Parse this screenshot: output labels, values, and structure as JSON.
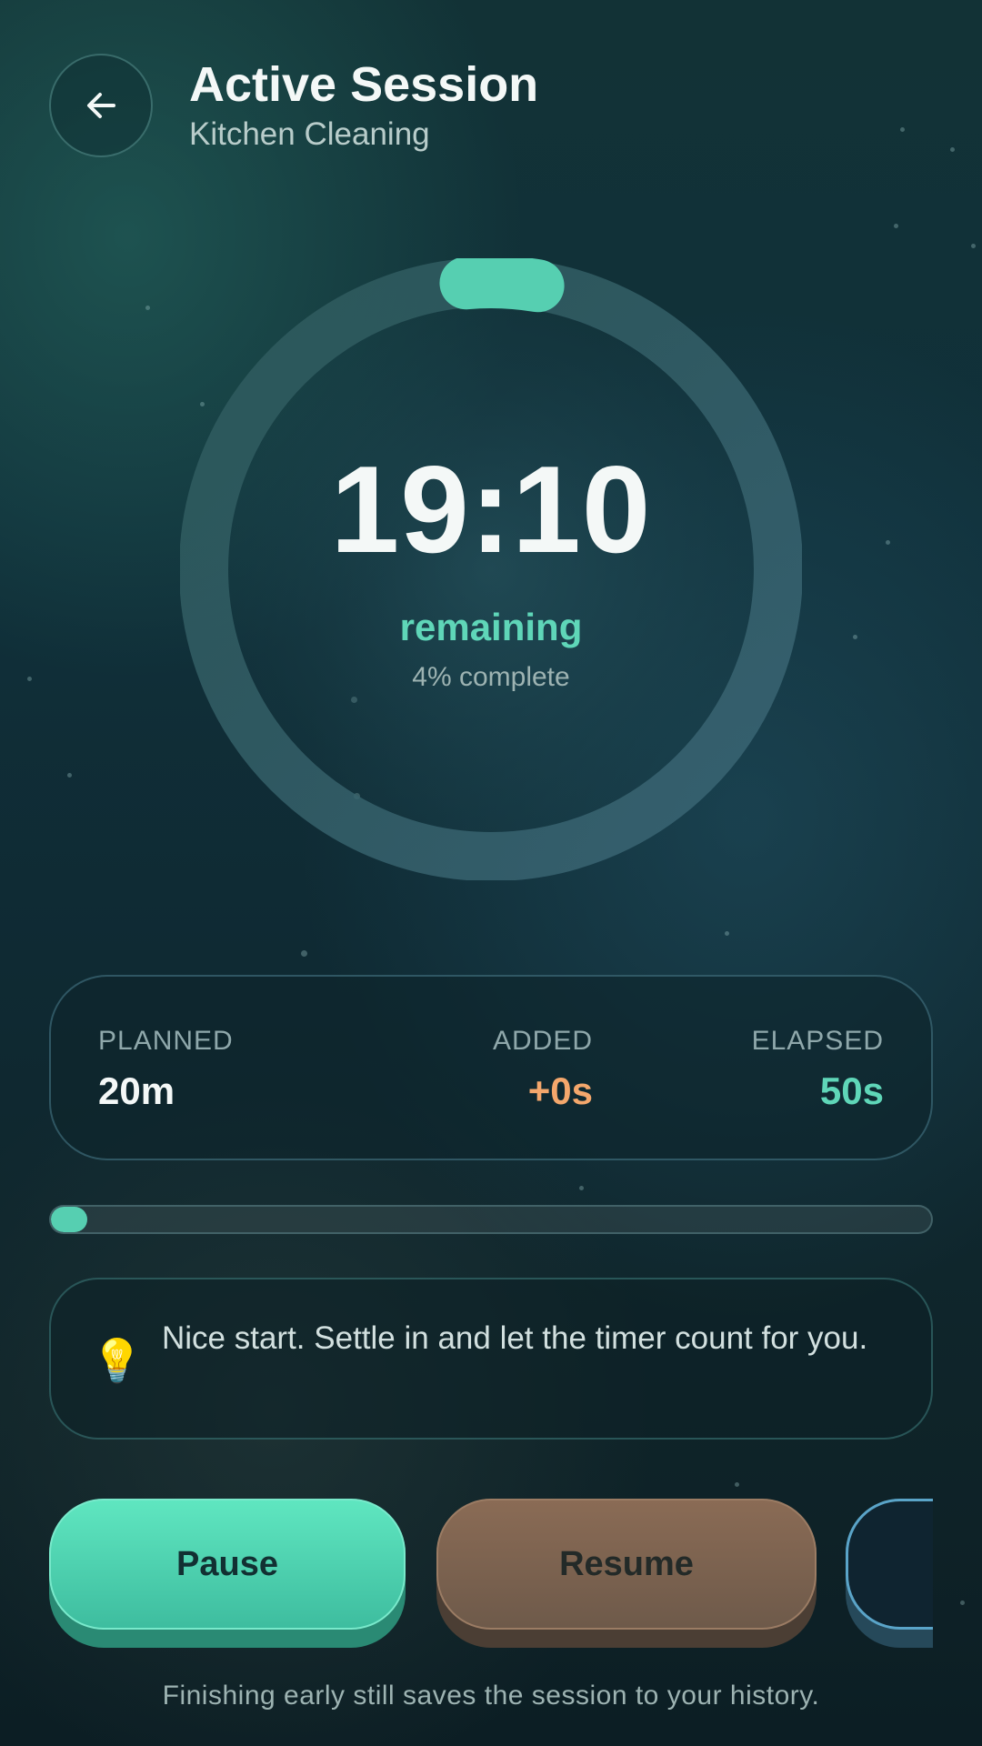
{
  "header": {
    "title": "Active Session",
    "subtitle": "Kitchen Cleaning",
    "back_icon": "arrow-left-icon"
  },
  "timer": {
    "time_remaining": "19:10",
    "remaining_label": "remaining",
    "complete_text": "4% complete",
    "progress_fraction": 0.04,
    "ring_color": "#56cfb1"
  },
  "stats": {
    "planned_label": "PLANNED",
    "planned_value": "20m",
    "added_label": "ADDED",
    "added_value": "+0s",
    "elapsed_label": "ELAPSED",
    "elapsed_value": "50s"
  },
  "progress_bar": {
    "fraction": 0.04
  },
  "tip": {
    "icon": "lightbulb-icon",
    "text": "Nice start. Settle in and let the timer count for you."
  },
  "actions": {
    "pause_label": "Pause",
    "resume_label": "Resume"
  },
  "footer_note": "Finishing early still saves the session to your history.",
  "colors": {
    "accent_green": "#5fd6b8",
    "added_orange": "#f4a76c",
    "resume_brown": "#8a6b55",
    "third_button_blue": "#5aa4c8"
  }
}
